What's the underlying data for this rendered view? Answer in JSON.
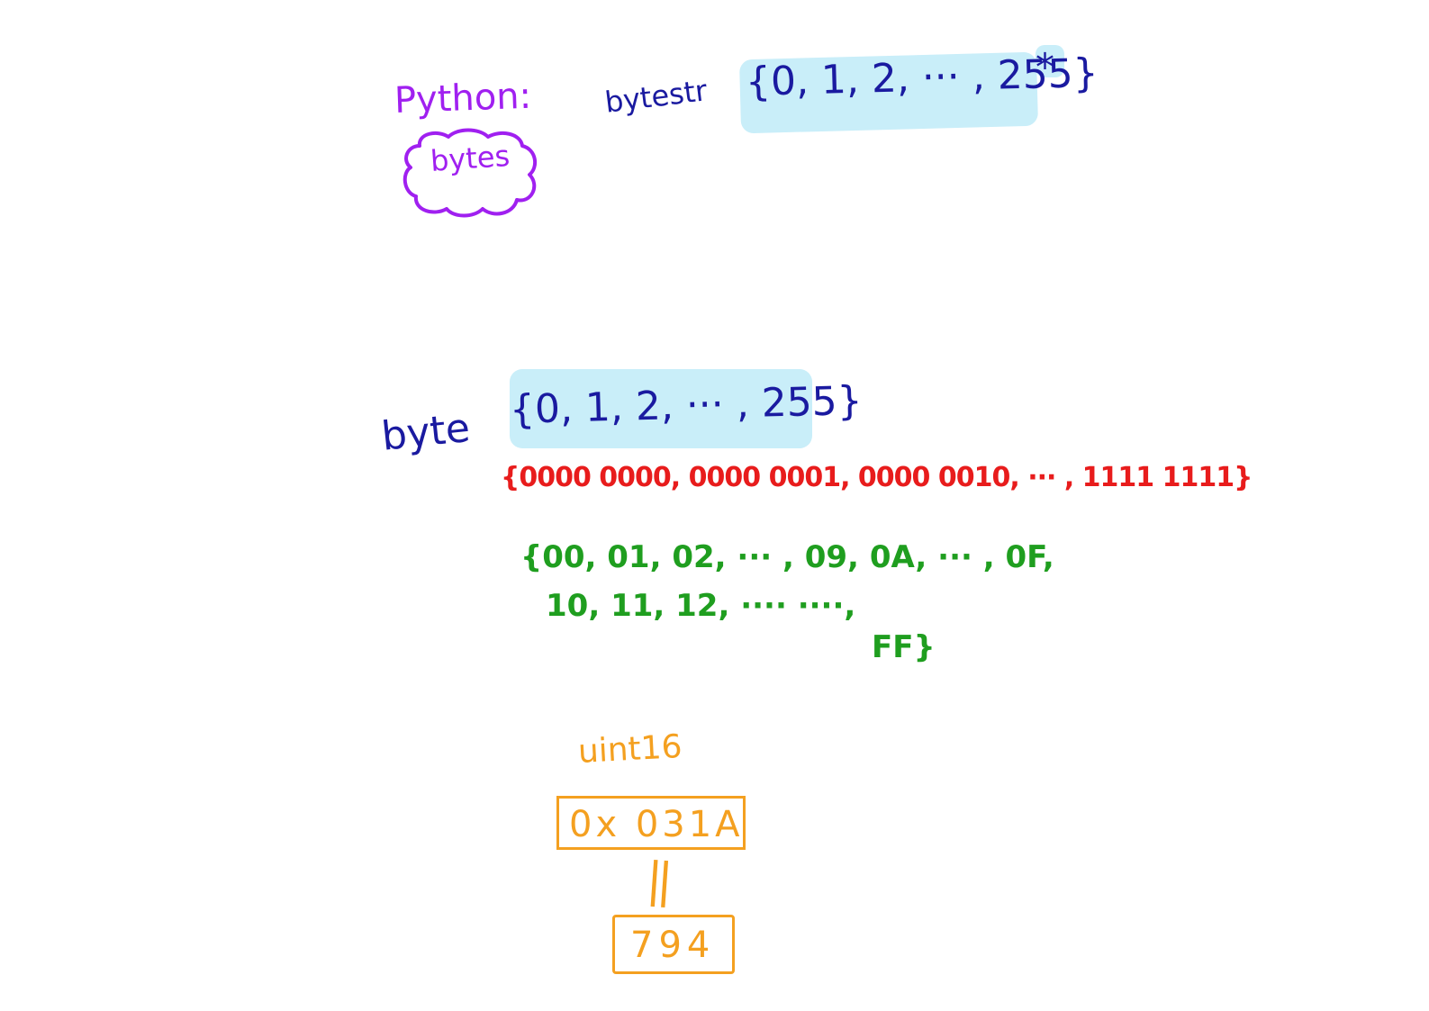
{
  "python": {
    "label": "Python:",
    "type_name": "bytes"
  },
  "bytestr": {
    "label": "bytestr",
    "set": "{0, 1, 2, ··· , 255}",
    "star": "*"
  },
  "byte": {
    "label": "byte",
    "decimal_set": "{0, 1, 2, ··· , 255}",
    "binary_set": "{0000 0000, 0000 0001, 0000 0010, ··· , 1111 1111}",
    "hex_line1": "{00, 01, 02, ··· , 09, 0A, ··· , 0F,",
    "hex_line2": "10, 11, 12, ···· ····,",
    "hex_line3": "FF}"
  },
  "uint16": {
    "label": "uint16",
    "hex_value": "0x 031A",
    "equals": "||",
    "decimal_value": "794"
  },
  "colors": {
    "python": "#a020f0",
    "blue_ink": "#1a1aa0",
    "highlight": "#c9eef9",
    "binary": "#e81c1c",
    "hex": "#1f9e1f",
    "uint16": "#f4a020"
  }
}
